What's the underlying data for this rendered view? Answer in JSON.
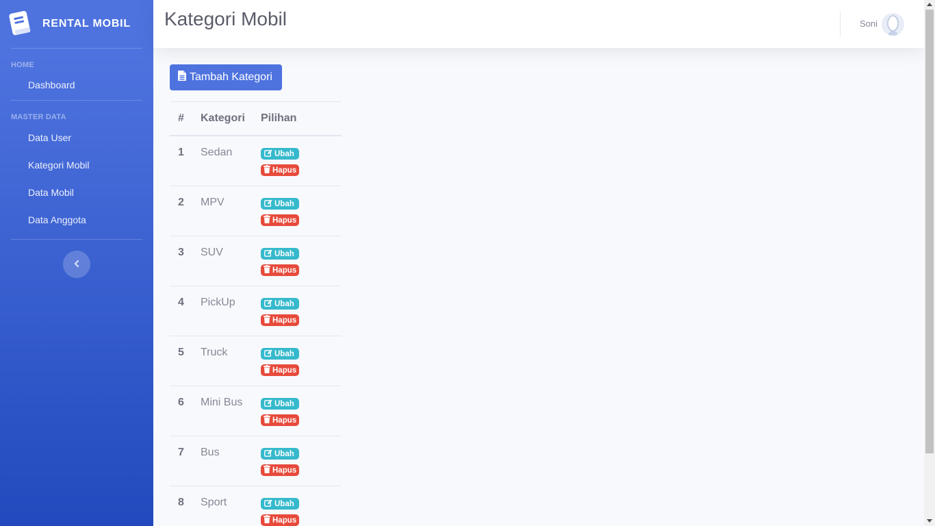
{
  "brand": {
    "name": "RENTAL MOBIL",
    "icon": "book-icon"
  },
  "sidebar": {
    "sections": [
      {
        "heading": "HOME",
        "items": [
          {
            "label": "Dashboard"
          }
        ]
      },
      {
        "heading": "MASTER DATA",
        "items": [
          {
            "label": "Data User"
          },
          {
            "label": "Kategori Mobil"
          },
          {
            "label": "Data Mobil"
          },
          {
            "label": "Data Anggota"
          }
        ]
      }
    ],
    "toggle_icon": "chevron-left-icon"
  },
  "topbar": {
    "title": "Kategori Mobil",
    "user_name": "Soni"
  },
  "actions": {
    "add_label": "Tambah Kategori",
    "add_icon": "file-icon"
  },
  "table": {
    "headers": [
      "#",
      "Kategori",
      "Pilihan"
    ],
    "edit_label": "Ubah",
    "delete_label": "Hapus",
    "rows": [
      {
        "no": "1",
        "kategori": "Sedan"
      },
      {
        "no": "2",
        "kategori": "MPV"
      },
      {
        "no": "3",
        "kategori": "SUV"
      },
      {
        "no": "4",
        "kategori": "PickUp"
      },
      {
        "no": "5",
        "kategori": "Truck"
      },
      {
        "no": "6",
        "kategori": "Mini Bus"
      },
      {
        "no": "7",
        "kategori": "Bus"
      },
      {
        "no": "8",
        "kategori": "Sport"
      }
    ]
  },
  "colors": {
    "primary": "#4e73df",
    "info": "#36b9cc",
    "danger": "#e74a3b",
    "sidebar_end": "#224abe"
  }
}
